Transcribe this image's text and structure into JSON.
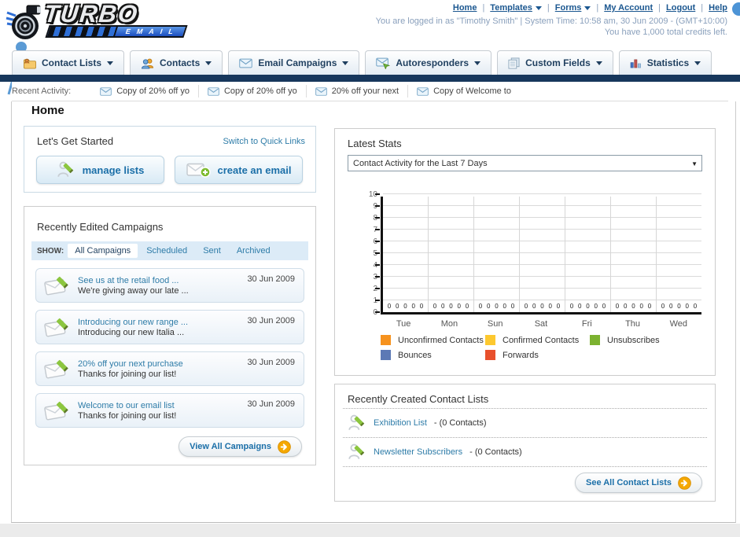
{
  "header": {
    "logo": {
      "primary": "TURBO",
      "secondary": "EMAIL"
    },
    "links": [
      {
        "label": "Home",
        "dropdown": false
      },
      {
        "label": "Templates",
        "dropdown": true
      },
      {
        "label": "Forms",
        "dropdown": true
      },
      {
        "label": "My Account",
        "dropdown": false
      },
      {
        "label": "Logout",
        "dropdown": false
      },
      {
        "label": "Help",
        "dropdown": false
      }
    ],
    "login_info": "You are logged in as \"Timothy Smith\" | System Time: 10:58 am, 30 Jun 2009 - (GMT+10:00)",
    "credits_info": "You have 1,000 total credits left."
  },
  "main_nav": {
    "tabs": [
      {
        "label": "Contact Lists",
        "icon": "contact-lists-icon"
      },
      {
        "label": "Contacts",
        "icon": "contacts-icon"
      },
      {
        "label": "Email Campaigns",
        "icon": "email-campaigns-icon"
      },
      {
        "label": "Autoresponders",
        "icon": "autoresponders-icon"
      },
      {
        "label": "Custom Fields",
        "icon": "custom-fields-icon"
      },
      {
        "label": "Statistics",
        "icon": "statistics-icon"
      }
    ]
  },
  "recent_activity": {
    "label": "Recent Activity:",
    "items": [
      {
        "label": "Copy of 20% off yo"
      },
      {
        "label": "Copy of 20% off yo"
      },
      {
        "label": "20% off your next"
      },
      {
        "label": "Copy of Welcome to"
      }
    ]
  },
  "page": {
    "title": "Home"
  },
  "get_started": {
    "title": "Let's Get Started",
    "switch_link": "Switch to Quick Links",
    "manage_lists_label": "manage lists",
    "create_email_label": "create an email"
  },
  "campaigns": {
    "title": "Recently Edited Campaigns",
    "show_label": "SHOW:",
    "filters": [
      {
        "label": "All Campaigns",
        "active": true
      },
      {
        "label": "Scheduled",
        "active": false
      },
      {
        "label": "Sent",
        "active": false
      },
      {
        "label": "Archived",
        "active": false
      }
    ],
    "items": [
      {
        "title": "See us at the retail food ...",
        "subtitle": "We're giving away our late ...",
        "date": "30 Jun 2009"
      },
      {
        "title": "Introducing our new range ...",
        "subtitle": "Introducing our new Italia ...",
        "date": "30 Jun 2009"
      },
      {
        "title": "20% off your next purchase",
        "subtitle": "Thanks for joining our list!",
        "date": "30 Jun 2009"
      },
      {
        "title": "Welcome to our email list",
        "subtitle": "Thanks for joining our list!",
        "date": "30 Jun 2009"
      }
    ],
    "view_all_label": "View All Campaigns"
  },
  "stats": {
    "title": "Latest Stats",
    "selected_option": "Contact Activity for the Last 7 Days"
  },
  "chart_data": {
    "type": "bar",
    "title": "Contact Activity for the Last 7 Days",
    "categories": [
      "Tue",
      "Mon",
      "Sun",
      "Sat",
      "Fri",
      "Thu",
      "Wed"
    ],
    "series": [
      {
        "name": "Unconfirmed Contacts",
        "color": "#F6921E",
        "values": [
          0,
          0,
          0,
          0,
          0,
          0,
          0
        ]
      },
      {
        "name": "Confirmed Contacts",
        "color": "#FDC82F",
        "values": [
          0,
          0,
          0,
          0,
          0,
          0,
          0
        ]
      },
      {
        "name": "Unsubscribes",
        "color": "#7CB230",
        "values": [
          0,
          0,
          0,
          0,
          0,
          0,
          0
        ]
      },
      {
        "name": "Bounces",
        "color": "#5C79B5",
        "values": [
          0,
          0,
          0,
          0,
          0,
          0,
          0
        ]
      },
      {
        "name": "Forwards",
        "color": "#E8502C",
        "values": [
          0,
          0,
          0,
          0,
          0,
          0,
          0
        ]
      }
    ],
    "ylim": [
      0,
      10
    ],
    "yticks": [
      0,
      1,
      2,
      3,
      4,
      5,
      6,
      7,
      8,
      9,
      10
    ],
    "grid": true,
    "legend_position": "bottom",
    "value_labels_shown": true
  },
  "contact_lists": {
    "title": "Recently Created Contact Lists",
    "items": [
      {
        "name": "Exhibition List",
        "count_label": "- (0 Contacts)"
      },
      {
        "name": "Newsletter Subscribers",
        "count_label": "- (0 Contacts)"
      }
    ],
    "see_all_label": "See All Contact Lists"
  },
  "colors": {
    "navy_bar": "#17375C",
    "link_blue": "#1B5790",
    "accent_blue": "#2E7CA8",
    "button_text_blue": "#1B6FA8",
    "orange_action": "#F5A800",
    "muted_bluegray": "#8AA0BC"
  }
}
